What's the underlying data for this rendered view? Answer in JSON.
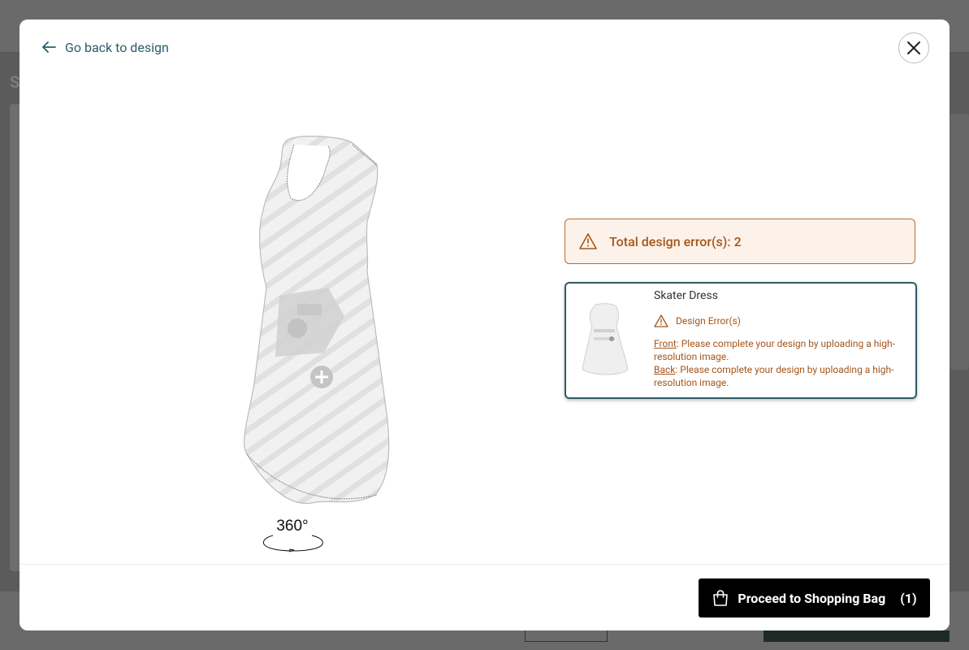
{
  "background": {
    "letter": "S"
  },
  "modal": {
    "back_label": "Go back to design",
    "three_sixty_label": "360°",
    "error_summary": "Total design error(s): 2",
    "product": {
      "title": "Skater Dress",
      "error_heading": "Design Error(s)",
      "errors": [
        {
          "side": "Front",
          "message": ": Please complete your design by uploading a high-",
          "message_cont": "resolution image."
        },
        {
          "side": "Back",
          "message": ": Please complete your design by uploading a high-",
          "message_cont": "resolution image."
        }
      ]
    },
    "proceed_label": "Proceed to Shopping Bag",
    "proceed_count": "(1)"
  },
  "colors": {
    "accent": "#2d5d68",
    "warning": "#a3561b",
    "warning_bg": "#fdf2ea",
    "button": "#000000"
  },
  "icons": {
    "back": "arrow-left-icon",
    "close": "close-icon",
    "warning": "warning-triangle-icon",
    "bag": "shopping-bag-icon",
    "rotate": "rotate-360-icon"
  }
}
